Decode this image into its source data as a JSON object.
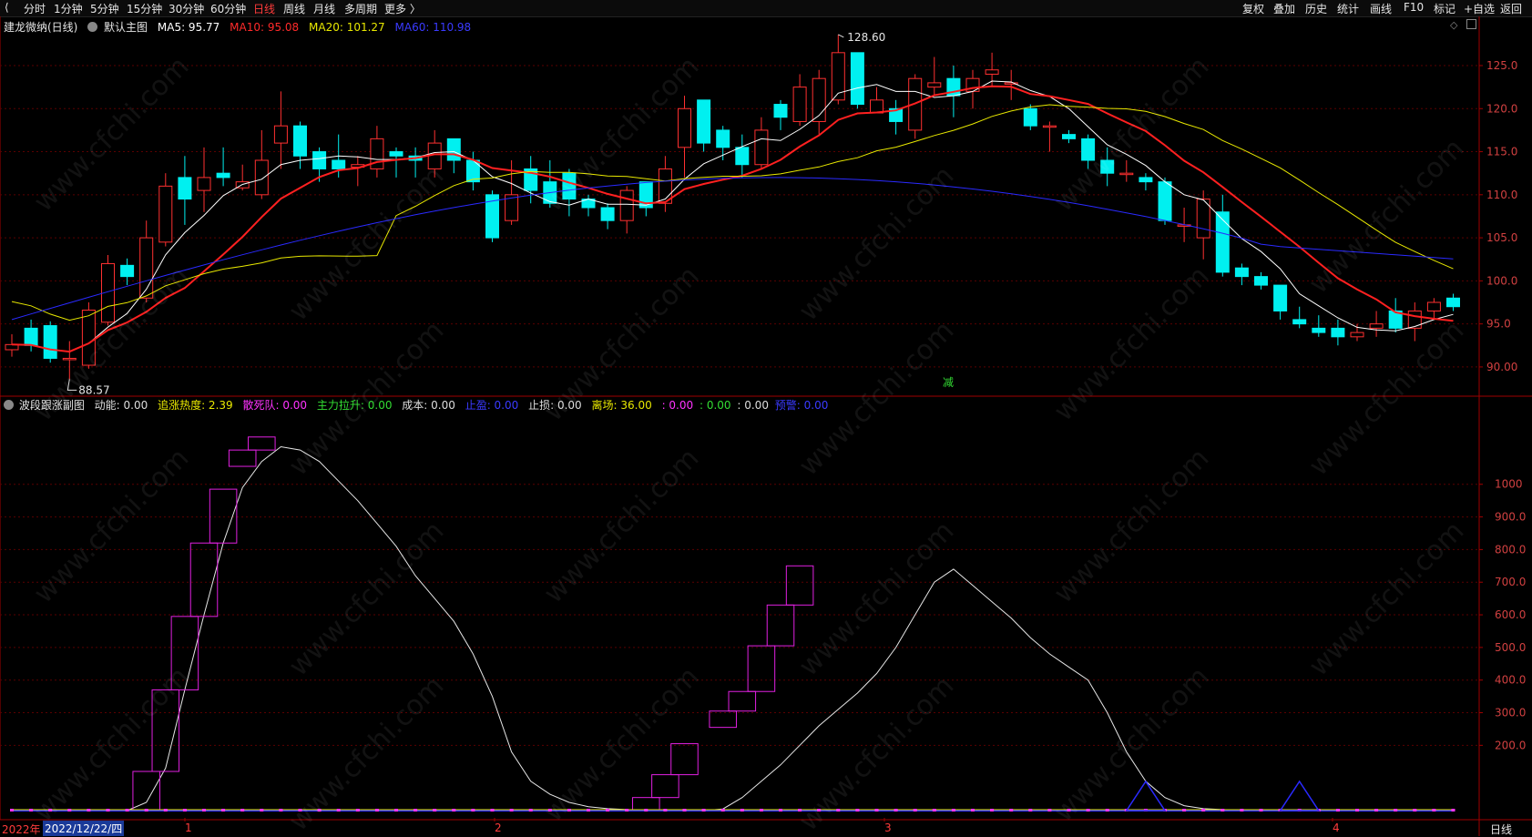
{
  "toolbar": {
    "periods": [
      "分时",
      "1分钟",
      "5分钟",
      "15分钟",
      "30分钟",
      "60分钟",
      "日线",
      "周线",
      "月线",
      "多周期",
      "更多 〉"
    ],
    "active_period": "日线",
    "right_items": [
      "复权",
      "叠加",
      "历史",
      "统计",
      "画线",
      "F10",
      "标记",
      "+自选",
      "返回"
    ]
  },
  "main_panel": {
    "title": "建龙微纳(日线)",
    "indicator_name": "默认主图",
    "ma": [
      {
        "label": "MA5: 95.77",
        "color": "#ffffff"
      },
      {
        "label": "MA10: 95.08",
        "color": "#ff2a2a"
      },
      {
        "label": "MA20: 101.27",
        "color": "#e8e800"
      },
      {
        "label": "MA60: 110.98",
        "color": "#2a2aff"
      }
    ],
    "high_label": "128.60",
    "low_label": "88.57",
    "reduce_marker": "减",
    "y_ticks": [
      "125.0",
      "120.0",
      "115.0",
      "110.0",
      "105.0",
      "100.0",
      "95.0",
      "90.00"
    ]
  },
  "sub_panel": {
    "title": "波段跟涨副图",
    "items": [
      {
        "label": "动能: 0.00",
        "color": "#dddddd"
      },
      {
        "label": "追涨热度: 2.39",
        "color": "#e8e800"
      },
      {
        "label": "散死队: 0.00",
        "color": "#ff33ff"
      },
      {
        "label": "主力拉升: 0.00",
        "color": "#33dd33"
      },
      {
        "label": "成本: 0.00",
        "color": "#dddddd"
      },
      {
        "label": "止盈: 0.00",
        "color": "#2a2aff"
      },
      {
        "label": "止损: 0.00",
        "color": "#dddddd"
      },
      {
        "label": "离场: 36.00",
        "color": "#e8e800"
      },
      {
        "label": ": 0.00",
        "color": "#ff33ff"
      },
      {
        "label": ": 0.00",
        "color": "#33dd33"
      },
      {
        "label": ": 0.00",
        "color": "#dddddd"
      },
      {
        "label": "预警: 0.00",
        "color": "#2a2aff"
      }
    ],
    "y_ticks": [
      "1000",
      "900.0",
      "800.0",
      "700.0",
      "600.0",
      "500.0",
      "400.0",
      "300.0",
      "200.0"
    ]
  },
  "status_bar": {
    "year_prefix": "2022年",
    "date_highlight": "2022/12/22/四",
    "month_ticks": [
      "1",
      "2",
      "3",
      "4"
    ],
    "period_label": "日线"
  },
  "watermark": "www.cfchi.com",
  "colors": {
    "up": "#ff3030",
    "down": "#00f0f0",
    "grid": "#5a0000",
    "axis": "#a00000"
  },
  "chart_data": {
    "type": "candlestick",
    "candles": [
      [
        92.0,
        92.6,
        91.2,
        93.8
      ],
      [
        94.5,
        92.5,
        91.8,
        95.5
      ],
      [
        94.8,
        91.0,
        90.5,
        95.3
      ],
      [
        91.0,
        91.0,
        88.57,
        93.0
      ],
      [
        90.2,
        96.6,
        89.8,
        97.5
      ],
      [
        95.2,
        102.0,
        94.8,
        103.0
      ],
      [
        101.8,
        100.5,
        99.5,
        102.6
      ],
      [
        98.0,
        105.0,
        97.5,
        107.0
      ],
      [
        104.5,
        111.0,
        104.0,
        112.5
      ],
      [
        112.0,
        109.5,
        106.5,
        114.5
      ],
      [
        110.5,
        112.0,
        108.0,
        115.5
      ],
      [
        112.5,
        112.0,
        111.0,
        115.5
      ],
      [
        110.8,
        111.5,
        110.5,
        113.5
      ],
      [
        110.0,
        114.0,
        109.5,
        117.5
      ],
      [
        116.0,
        118.0,
        113.0,
        122.0
      ],
      [
        118.0,
        114.5,
        113.0,
        118.5
      ],
      [
        115.0,
        113.0,
        111.5,
        115.5
      ],
      [
        114.0,
        113.0,
        112.0,
        117.0
      ],
      [
        113.2,
        113.5,
        111.0,
        114.5
      ],
      [
        113.0,
        116.5,
        112.0,
        118.0
      ],
      [
        115.0,
        114.5,
        112.0,
        115.5
      ],
      [
        114.5,
        114.0,
        112.0,
        115.5
      ],
      [
        113.0,
        116.0,
        112.0,
        117.5
      ],
      [
        116.5,
        114.0,
        112.5,
        116.5
      ],
      [
        114.0,
        111.5,
        110.5,
        115.0
      ],
      [
        110.0,
        105.0,
        104.5,
        110.5
      ],
      [
        107.0,
        110.0,
        106.5,
        114.0
      ],
      [
        113.0,
        110.5,
        109.0,
        114.5
      ],
      [
        111.5,
        109.0,
        108.5,
        114.0
      ],
      [
        112.5,
        109.5,
        107.5,
        113.0
      ],
      [
        109.5,
        108.5,
        107.5,
        110.0
      ],
      [
        108.5,
        107.0,
        106.0,
        109.0
      ],
      [
        107.0,
        110.5,
        105.5,
        111.0
      ],
      [
        111.5,
        108.5,
        107.5,
        111.5
      ],
      [
        109.0,
        113.0,
        108.0,
        114.5
      ],
      [
        115.5,
        120.0,
        112.0,
        121.5
      ],
      [
        121.0,
        116.0,
        115.0,
        121.0
      ],
      [
        117.5,
        115.5,
        114.0,
        118.0
      ],
      [
        115.5,
        113.5,
        112.0,
        117.0
      ],
      [
        113.5,
        117.5,
        113.0,
        119.0
      ],
      [
        120.5,
        119.0,
        117.5,
        121.0
      ],
      [
        118.5,
        122.5,
        118.0,
        124.0
      ],
      [
        118.5,
        123.5,
        117.0,
        124.5
      ],
      [
        121.0,
        126.5,
        120.5,
        128.6
      ],
      [
        126.5,
        120.5,
        120.0,
        126.5
      ],
      [
        119.5,
        121.0,
        119.5,
        122.5
      ],
      [
        120.0,
        118.5,
        117.0,
        121.0
      ],
      [
        117.5,
        123.5,
        116.5,
        124.0
      ],
      [
        122.5,
        123.0,
        121.5,
        126.0
      ],
      [
        123.5,
        121.5,
        119.0,
        125.0
      ],
      [
        122.0,
        123.5,
        120.0,
        124.5
      ],
      [
        124.0,
        124.5,
        122.5,
        126.5
      ],
      [
        123.0,
        123.0,
        121.0,
        124.5
      ],
      [
        120.0,
        118.0,
        117.5,
        120.5
      ],
      [
        118.0,
        118.0,
        115.0,
        118.5
      ],
      [
        117.0,
        116.5,
        116.0,
        117.5
      ],
      [
        116.5,
        114.0,
        113.0,
        117.0
      ],
      [
        114.0,
        112.5,
        111.0,
        115.5
      ],
      [
        112.5,
        112.5,
        111.5,
        114.0
      ],
      [
        112.0,
        111.5,
        110.5,
        112.5
      ],
      [
        111.5,
        107.0,
        106.5,
        112.0
      ],
      [
        106.5,
        106.5,
        104.5,
        108.5
      ],
      [
        105.0,
        109.5,
        102.5,
        110.5
      ],
      [
        108.0,
        101.0,
        100.5,
        110.0
      ],
      [
        101.5,
        100.5,
        99.5,
        102.0
      ],
      [
        100.5,
        99.5,
        99.0,
        101.0
      ],
      [
        99.5,
        96.5,
        95.5,
        99.5
      ],
      [
        95.5,
        95.0,
        94.5,
        97.0
      ],
      [
        94.5,
        94.0,
        93.5,
        96.0
      ],
      [
        94.5,
        93.5,
        92.5,
        95.5
      ],
      [
        93.5,
        94.0,
        93.0,
        95.0
      ],
      [
        94.5,
        95.0,
        93.5,
        96.5
      ],
      [
        96.5,
        94.5,
        94.0,
        98.0
      ],
      [
        94.5,
        96.5,
        93.0,
        97.5
      ],
      [
        96.5,
        97.5,
        95.5,
        98.0
      ],
      [
        98.0,
        97.0,
        96.5,
        98.5
      ]
    ],
    "y_range": [
      86.5,
      130.5
    ],
    "sub_values": [
      0,
      0,
      0,
      0,
      0,
      0,
      0,
      30,
      140,
      370,
      600,
      820,
      990,
      1070,
      1115,
      1115,
      1100,
      1060,
      1010,
      950,
      880,
      800,
      720,
      650,
      570,
      480,
      350,
      220,
      120,
      60,
      30,
      15,
      8,
      4,
      2,
      1,
      0,
      0,
      0,
      0,
      0,
      0,
      0,
      0,
      0,
      0,
      0,
      0,
      0,
      0,
      0,
      0,
      0,
      0,
      0,
      0,
      0,
      0,
      0,
      0,
      0,
      0,
      0,
      0,
      0,
      0,
      0,
      0,
      0,
      0,
      0,
      0,
      0,
      0,
      0,
      0
    ],
    "sub_white": [
      0,
      0,
      0,
      0,
      0,
      0,
      0,
      25,
      130,
      370,
      600,
      820,
      990,
      1070,
      1115,
      1105,
      1070,
      1010,
      950,
      880,
      810,
      720,
      650,
      580,
      480,
      350,
      180,
      90,
      50,
      25,
      12,
      6,
      3,
      2,
      1,
      0,
      0,
      5,
      40,
      90,
      140,
      200,
      260,
      310,
      360,
      420,
      500,
      600,
      700,
      740,
      690,
      640,
      590,
      530,
      480,
      440,
      400,
      300,
      180,
      90,
      40,
      15,
      6,
      3,
      1,
      0,
      0,
      0,
      0,
      0,
      0,
      0,
      0,
      0,
      0,
      0
    ],
    "sub_boxes": [
      {
        "i": 7,
        "lo": 0,
        "hi": 120
      },
      {
        "i": 8,
        "lo": 120,
        "hi": 370
      },
      {
        "i": 9,
        "lo": 370,
        "hi": 595
      },
      {
        "i": 10,
        "lo": 595,
        "hi": 820
      },
      {
        "i": 11,
        "lo": 820,
        "hi": 985
      },
      {
        "i": 12,
        "lo": 1055,
        "hi": 1105
      },
      {
        "i": 13,
        "lo": 1105,
        "hi": 1145
      },
      {
        "i": 33,
        "lo": 0,
        "hi": 40
      },
      {
        "i": 34,
        "lo": 40,
        "hi": 110
      },
      {
        "i": 35,
        "lo": 110,
        "hi": 205
      },
      {
        "i": 37,
        "lo": 255,
        "hi": 305
      },
      {
        "i": 38,
        "lo": 305,
        "hi": 365
      },
      {
        "i": 39,
        "lo": 365,
        "hi": 505
      },
      {
        "i": 40,
        "lo": 505,
        "hi": 630
      },
      {
        "i": 41,
        "lo": 630,
        "hi": 750
      }
    ],
    "sub_y_range": [
      0,
      1150
    ],
    "triangles": [
      59,
      67
    ]
  }
}
